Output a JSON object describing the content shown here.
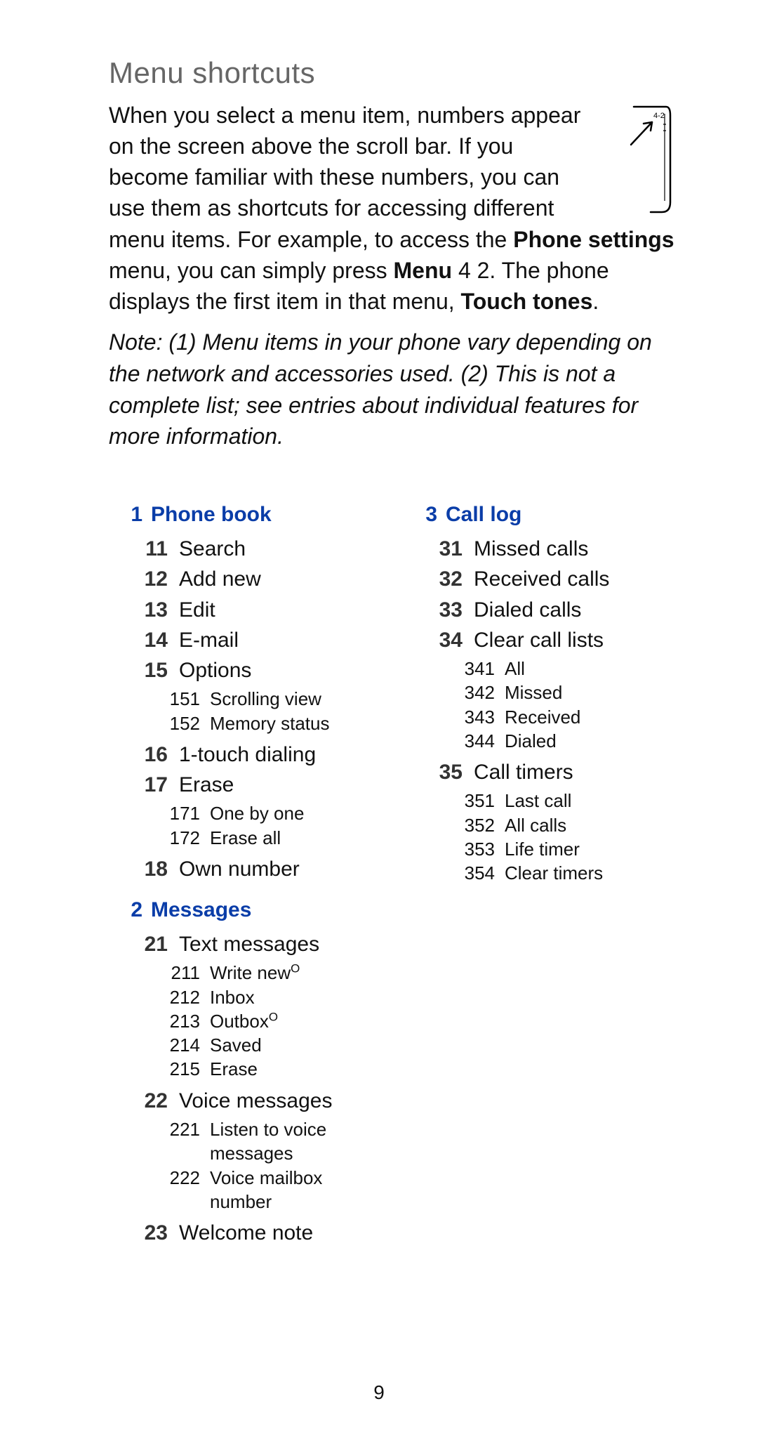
{
  "page": {
    "title": "Menu shortcuts",
    "intro_prefix": "When you select a menu item, numbers appear on the screen above the scroll bar. If you become familiar with these numbers, you can use them as shortcuts for accessing different menu items. For example, to access the ",
    "intro_bold1": "Phone settings",
    "intro_mid1": " menu, you can simply press ",
    "intro_bold2": "Menu",
    "intro_mid2": " 4 2. The phone displays the first item in that menu, ",
    "intro_bold3": "Touch tones",
    "intro_suffix": ".",
    "note": "Note: (1) Menu items in your phone vary depending on the network and accessories used. (2) This is not a complete list; see entries about individual features for more information.",
    "phone_graphic_label": "4-2",
    "page_number": "9"
  },
  "menus": {
    "m1": {
      "num": "1",
      "label": "Phone book"
    },
    "m1_items": {
      "i11": {
        "num": "11",
        "label": "Search"
      },
      "i12": {
        "num": "12",
        "label": "Add new"
      },
      "i13": {
        "num": "13",
        "label": "Edit"
      },
      "i14": {
        "num": "14",
        "label": "E-mail"
      },
      "i15": {
        "num": "15",
        "label": "Options"
      },
      "i15_s151": {
        "num": "151",
        "label": "Scrolling view"
      },
      "i15_s152": {
        "num": "152",
        "label": "Memory status"
      },
      "i16": {
        "num": "16",
        "label": "1-touch dialing"
      },
      "i17": {
        "num": "17",
        "label": "Erase"
      },
      "i17_s171": {
        "num": "171",
        "label": "One by one"
      },
      "i17_s172": {
        "num": "172",
        "label": "Erase all"
      },
      "i18": {
        "num": "18",
        "label": "Own number"
      }
    },
    "m2": {
      "num": "2",
      "label": "Messages"
    },
    "m2_items": {
      "i21": {
        "num": "21",
        "label": "Text messages"
      },
      "i21_s211": {
        "num": "211",
        "label": "Write new",
        "sup": "O"
      },
      "i21_s212": {
        "num": "212",
        "label": "Inbox"
      },
      "i21_s213": {
        "num": "213",
        "label": "Outbox",
        "sup": "O"
      },
      "i21_s214": {
        "num": "214",
        "label": "Saved"
      },
      "i21_s215": {
        "num": "215",
        "label": "Erase"
      },
      "i22": {
        "num": "22",
        "label": "Voice messages"
      },
      "i22_s221": {
        "num": "221",
        "label": "Listen to voice messages"
      },
      "i22_s222": {
        "num": "222",
        "label": "Voice mailbox number"
      },
      "i23": {
        "num": "23",
        "label": "Welcome note"
      }
    },
    "m3": {
      "num": "3",
      "label": "Call log"
    },
    "m3_items": {
      "i31": {
        "num": "31",
        "label": "Missed calls"
      },
      "i32": {
        "num": "32",
        "label": "Received calls"
      },
      "i33": {
        "num": "33",
        "label": "Dialed calls"
      },
      "i34": {
        "num": "34",
        "label": "Clear call lists"
      },
      "i34_s341": {
        "num": "341",
        "label": "All"
      },
      "i34_s342": {
        "num": "342",
        "label": "Missed"
      },
      "i34_s343": {
        "num": "343",
        "label": "Received"
      },
      "i34_s344": {
        "num": "344",
        "label": "Dialed"
      },
      "i35": {
        "num": "35",
        "label": "Call timers"
      },
      "i35_s351": {
        "num": "351",
        "label": "Last call"
      },
      "i35_s352": {
        "num": "352",
        "label": "All calls"
      },
      "i35_s353": {
        "num": "353",
        "label": "Life timer"
      },
      "i35_s354": {
        "num": "354",
        "label": "Clear timers"
      }
    }
  }
}
